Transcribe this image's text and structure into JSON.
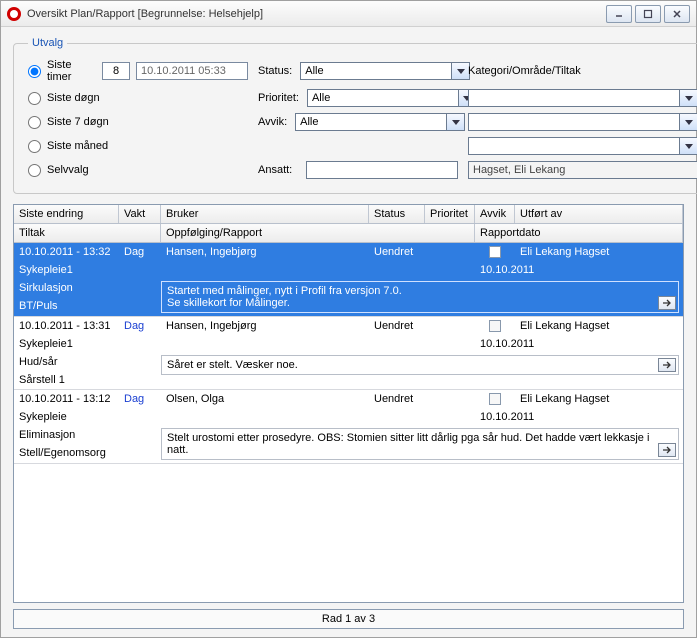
{
  "window": {
    "title": "Oversikt Plan/Rapport   [Begrunnelse: Helsehjelp]"
  },
  "utvalg": {
    "legend": "Utvalg",
    "radios": {
      "siste_timer": "Siste timer",
      "siste_dogn": "Siste døgn",
      "siste_7dogn": "Siste 7 døgn",
      "siste_maned": "Siste måned",
      "selvvalg": "Selvvalg"
    },
    "hours_value": "8",
    "datetime_value": "10.10.2011 05:33",
    "labels": {
      "status": "Status:",
      "prioritet": "Prioritet:",
      "avvik": "Avvik:",
      "ansatt": "Ansatt:",
      "kategori": "Kategori/Område/Tiltak"
    },
    "status_value": "Alle",
    "prioritet_value": "Alle",
    "avvik_value": "Alle",
    "ansatt_value": "",
    "kategori1": "",
    "kategori2": "",
    "kategori3": "",
    "ansatt_readonly": "Hagset, Eli Lekang"
  },
  "grid": {
    "headers1": {
      "siste_endring": "Siste endring",
      "vakt": "Vakt",
      "bruker": "Bruker",
      "status": "Status",
      "prioritet": "Prioritet",
      "avvik": "Avvik",
      "utfort_av": "Utført av"
    },
    "headers2": {
      "tiltak": "Tiltak",
      "oppfolging": "Oppfølging/Rapport",
      "rapportdato": "Rapportdato"
    },
    "rows": [
      {
        "endring": "10.10.2011 - 13:32",
        "vakt": "Dag",
        "bruker": "Hansen, Ingebjørg",
        "status": "Uendret",
        "utfort": "Eli Lekang Hagset",
        "tiltak": "Sykepleie1",
        "rapportdato": "10.10.2011",
        "sub1": "Sirkulasjon",
        "sub2": "BT/Puls",
        "note": "Startet med målinger, nytt i Profil fra versjon 7.0.\nSe skillekort for Målinger.",
        "selected": true
      },
      {
        "endring": "10.10.2011 - 13:31",
        "vakt": "Dag",
        "bruker": "Hansen, Ingebjørg",
        "status": "Uendret",
        "utfort": "Eli Lekang Hagset",
        "tiltak": "Sykepleie1",
        "rapportdato": "10.10.2011",
        "sub1": "Hud/sår",
        "sub2": "Sårstell 1",
        "note": "Såret er stelt. Væsker noe.",
        "selected": false
      },
      {
        "endring": "10.10.2011 - 13:12",
        "vakt": "Dag",
        "bruker": "Olsen, Olga",
        "status": "Uendret",
        "utfort": "Eli Lekang Hagset",
        "tiltak": "Sykepleie",
        "rapportdato": "10.10.2011",
        "sub1": "Eliminasjon",
        "sub2": "Stell/Egenomsorg",
        "note": "Stelt urostomi etter prosedyre. OBS: Stomien sitter litt dårlig pga sår hud. Det hadde vært lekkasje i natt.",
        "selected": false
      }
    ]
  },
  "statusbar": "Rad 1 av 3"
}
